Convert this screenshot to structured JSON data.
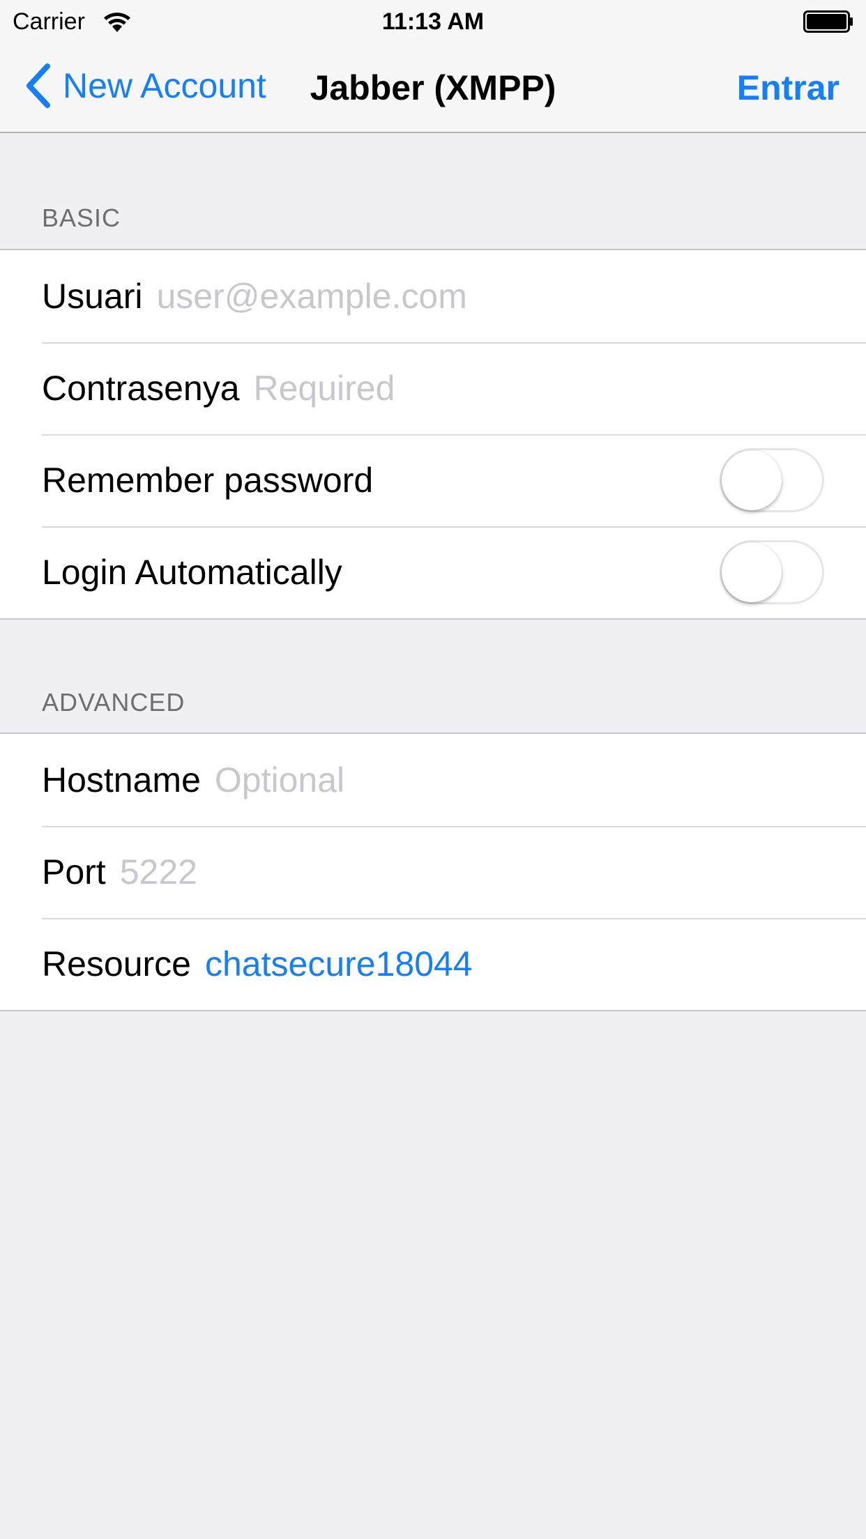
{
  "status_bar": {
    "carrier": "Carrier",
    "time": "11:13 AM",
    "wifi_icon": "wifi-icon",
    "battery_icon": "battery-icon"
  },
  "nav": {
    "back_label": "New Account",
    "title": "Jabber (XMPP)",
    "action_label": "Entrar",
    "accent_color": "#157efb"
  },
  "basic": {
    "header": "BASIC",
    "username": {
      "label": "Usuari",
      "value": "",
      "placeholder": "user@example.com"
    },
    "password": {
      "label": "Contrasenya",
      "value": "",
      "placeholder": "Required"
    },
    "remember_password": {
      "label": "Remember password",
      "on": false
    },
    "login_automatically": {
      "label": "Login Automatically",
      "on": false
    }
  },
  "advanced": {
    "header": "ADVANCED",
    "hostname": {
      "label": "Hostname",
      "value": "",
      "placeholder": "Optional"
    },
    "port": {
      "label": "Port",
      "value": "",
      "placeholder": "5222"
    },
    "resource": {
      "label": "Resource",
      "value": "chatsecure18044"
    }
  }
}
